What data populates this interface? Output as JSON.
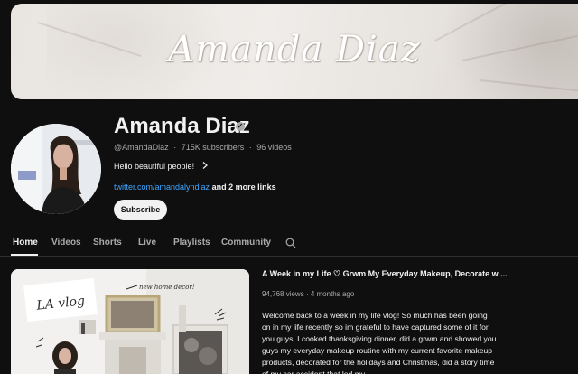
{
  "banner": {
    "logo_text": "Amanda Diaz"
  },
  "channel": {
    "name": "Amanda Diaz",
    "handle": "@AmandaDiaz",
    "subscribers": "715K subscribers",
    "videos": "96 videos",
    "separator": "·",
    "tagline": "Hello beautiful people!",
    "link_url": "twitter.com/amandalyndiaz",
    "link_more": " and 2 more links",
    "subscribe_label": "Subscribe"
  },
  "tabs": [
    {
      "label": "Home",
      "active": true
    },
    {
      "label": "Videos"
    },
    {
      "label": "Shorts"
    },
    {
      "label": "Live"
    },
    {
      "label": "Playlists"
    },
    {
      "label": "Community"
    }
  ],
  "featured_video": {
    "title": "A Week in my Life ♡ Grwm My Everyday Makeup, Decorate w ...",
    "views": "94,768 views",
    "age": "4 months ago",
    "thumbnail_text": {
      "vlog": "LA vlog",
      "note": "new home decor!"
    },
    "description": "Welcome back to a week in my life vlog! So much has been going on in my life recently so im grateful to have captured some of it for you guys. I cooked thanksgiving dinner, did a grwm and showed you guys my everyday makeup routine with my current favorite makeup products, decorated for the holidays and Christmas, did a story time of my car accident that led my"
  },
  "colors": {
    "background": "#0f0f0f",
    "text": "#f1f1f1",
    "muted": "#aaaaaa",
    "link": "#3ea6ff"
  }
}
